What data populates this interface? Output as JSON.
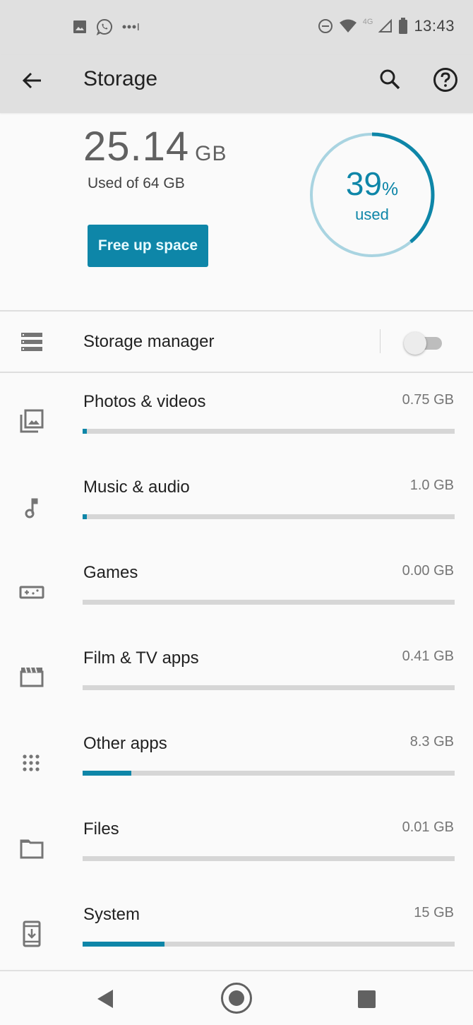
{
  "status_bar": {
    "notification_icons": [
      "gallery-icon",
      "whatsapp-icon",
      "more-notifications-icon"
    ],
    "system_icons": [
      "do-not-disturb-icon",
      "wifi-icon",
      "signal-icon",
      "battery-icon"
    ],
    "network_label": "4G",
    "time": "13:43"
  },
  "app_bar": {
    "title": "Storage",
    "back_icon": "arrow-back-icon",
    "actions": [
      "search-icon",
      "help-icon"
    ]
  },
  "summary": {
    "used_value": "25.14",
    "used_unit": "GB",
    "used_of_label": "Used of 64 GB",
    "free_up_button": "Free up space",
    "percent_used": 39,
    "percent_label": "39",
    "percent_sign": "%",
    "used_word": "used",
    "accent_color": "#0e86a8",
    "ring_track_color": "#a9d4e1"
  },
  "storage_manager": {
    "label": "Storage manager",
    "enabled": false
  },
  "categories": [
    {
      "label": "Photos & videos",
      "size": "0.75 GB",
      "fraction": 0.01,
      "icon": "photo-library-icon"
    },
    {
      "label": "Music & audio",
      "size": "1.0 GB",
      "fraction": 0.01,
      "icon": "music-note-icon"
    },
    {
      "label": "Games",
      "size": "0.00 GB",
      "fraction": 0.0,
      "icon": "gamepad-icon"
    },
    {
      "label": "Film & TV apps",
      "size": "0.41 GB",
      "fraction": 0.0,
      "icon": "movie-clapper-icon"
    },
    {
      "label": "Other apps",
      "size": "8.3 GB",
      "fraction": 0.13,
      "icon": "apps-grid-icon"
    },
    {
      "label": "Files",
      "size": "0.01 GB",
      "fraction": 0.0,
      "icon": "folder-icon"
    },
    {
      "label": "System",
      "size": "15 GB",
      "fraction": 0.22,
      "icon": "system-update-icon"
    }
  ],
  "nav_bar": {
    "buttons": [
      "back-nav-icon",
      "home-nav-icon",
      "recents-nav-icon"
    ]
  }
}
